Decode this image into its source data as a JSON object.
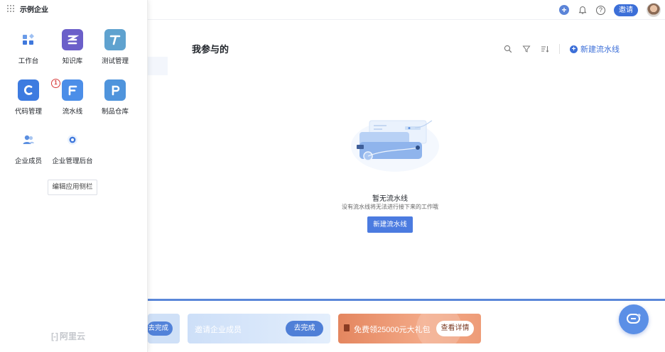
{
  "topbar": {
    "invite_label": "邀请"
  },
  "drawer": {
    "org_name": "示例企业",
    "apps": [
      {
        "label": "工作台",
        "icon": "workbench-icon"
      },
      {
        "label": "知识库",
        "icon": "knowledge-base-icon"
      },
      {
        "label": "测试管理",
        "icon": "test-management-icon"
      },
      {
        "label": "代码管理",
        "icon": "code-management-icon"
      },
      {
        "label": "流水线",
        "icon": "pipeline-icon"
      },
      {
        "label": "制品仓库",
        "icon": "artifact-repo-icon"
      },
      {
        "label": "企业成员",
        "icon": "members-icon"
      },
      {
        "label": "企业管理后台",
        "icon": "admin-console-icon"
      }
    ],
    "badge_number": "1",
    "edit_sidebar_label": "编辑应用侧栏",
    "footer_logo_text": "阿里云"
  },
  "main": {
    "title": "我参与的",
    "new_pipeline_link": "新建流水线",
    "empty": {
      "title": "暂无流水线",
      "description": "没有流水线将无法进行接下来的工作哦",
      "button": "新建流水线"
    }
  },
  "promo": {
    "card1_button": "去完成",
    "card2_text": "邀请企业成员",
    "card2_button": "去完成",
    "card3_text": "免费领25000元大礼包",
    "card3_button": "查看详情"
  },
  "colors": {
    "primary": "#3c6fd8",
    "promo_orange": "#e4865f",
    "badge_red": "#d83a3a"
  }
}
